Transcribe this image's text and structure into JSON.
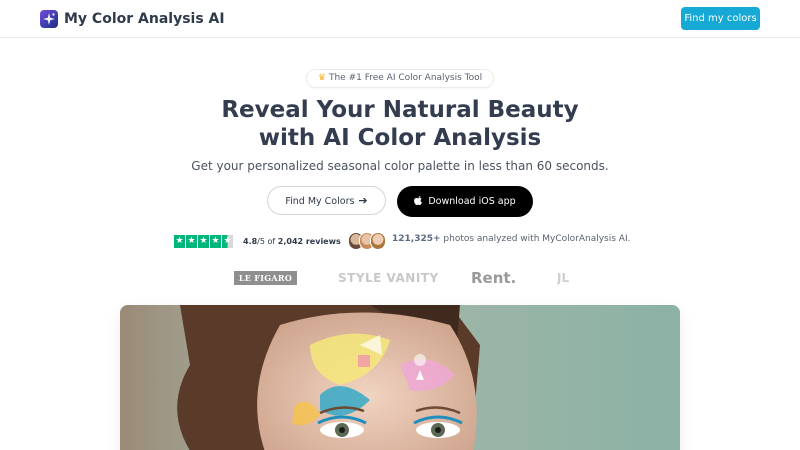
{
  "header": {
    "brand": "My Color Analysis AI",
    "cta_label": "Find my colors",
    "logo_icon": "sparkle-logo-icon"
  },
  "hero": {
    "badge": "The #1 Free AI Color Analysis Tool",
    "badge_icon": "crown-icon",
    "headline_line1": "Reveal Your Natural Beauty",
    "headline_line2": "with AI Color Analysis",
    "subheadline": "Get your personalized seasonal color palette in less than 60 seconds.",
    "primary_button": "Find My Colors",
    "secondary_button": "Download iOS app",
    "primary_button_icon": "arrow-right-icon",
    "secondary_button_icon": "apple-icon"
  },
  "social_proof": {
    "rating_value": "4.8",
    "rating_scale": "/5 of ",
    "review_count": "2,042 reviews",
    "stars": 4.5,
    "photos_count": "121,325+",
    "photos_text": " photos analyzed with MyColorAnalysis AI."
  },
  "press": {
    "logos": [
      "LE FIGARO",
      "STYLE VANITY",
      "Rent.",
      "JL"
    ]
  },
  "colors": {
    "accent": "#17a9d6",
    "headline": "#333d4f",
    "trustpilot_green": "#00b67a"
  },
  "hero_image": {
    "alt_subject": "woman-with-colorful-face-paint-image"
  }
}
